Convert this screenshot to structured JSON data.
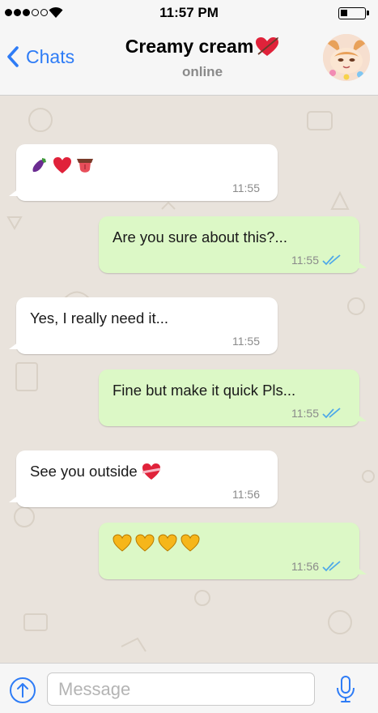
{
  "status_bar": {
    "time": "11:57 PM",
    "signal_icon": "cellular-signal-icon",
    "wifi_icon": "wifi-icon",
    "battery_icon": "battery-icon",
    "battery_level": 0.2
  },
  "header": {
    "back_label": "Chats",
    "contact_name": "Creamy cream",
    "contact_status": "online",
    "accent_color": "#2e7cf6"
  },
  "messages": [
    {
      "direction": "incoming",
      "emojis": [
        "eggplant",
        "red-heart",
        "tongue"
      ],
      "text": "",
      "time": "11:55"
    },
    {
      "direction": "outgoing",
      "text": "Are you sure about this?...",
      "time": "11:55",
      "read": true
    },
    {
      "direction": "incoming",
      "text": "Yes, I really need it...",
      "time": "11:55"
    },
    {
      "direction": "outgoing",
      "text": "Fine but make it quick Pls...",
      "time": "11:55",
      "read": true
    },
    {
      "direction": "incoming",
      "text": "See you outside",
      "emojis": [
        "heart-with-ribbon"
      ],
      "time": "11:56"
    },
    {
      "direction": "outgoing",
      "emojis": [
        "yellow-heart",
        "yellow-heart",
        "yellow-heart",
        "yellow-heart"
      ],
      "text": "",
      "time": "11:56",
      "read": true
    }
  ],
  "input": {
    "placeholder": "Message",
    "value": "",
    "attach_icon": "upload-arrow-icon",
    "mic_icon": "microphone-icon"
  },
  "colors": {
    "incoming_bubble": "#ffffff",
    "outgoing_bubble": "#dcf8c6",
    "read_ticks": "#4fa9e8",
    "chat_background": "#e9e3dc"
  }
}
